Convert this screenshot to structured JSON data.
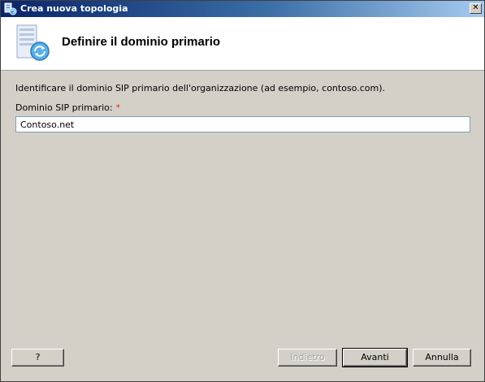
{
  "window": {
    "title": "Crea nuova topologia",
    "close_glyph": "✕"
  },
  "header": {
    "title": "Definire il dominio primario",
    "icon": "server-sync-icon"
  },
  "main": {
    "instruction": "Identificare il dominio SIP primario dell'organizzazione (ad esempio, contoso.com).",
    "sip_domain_label": "Dominio SIP primario:",
    "required_marker": "*",
    "sip_domain_value": "Contoso.net"
  },
  "footer": {
    "help_label": "?",
    "back_label": "Indietro",
    "next_label": "Avanti",
    "cancel_label": "Annulla"
  },
  "colors": {
    "titlebar_start": "#0a246a",
    "titlebar_end": "#a6caf0",
    "required": "#e0301e",
    "dialog_bg": "#d4d0c8"
  }
}
